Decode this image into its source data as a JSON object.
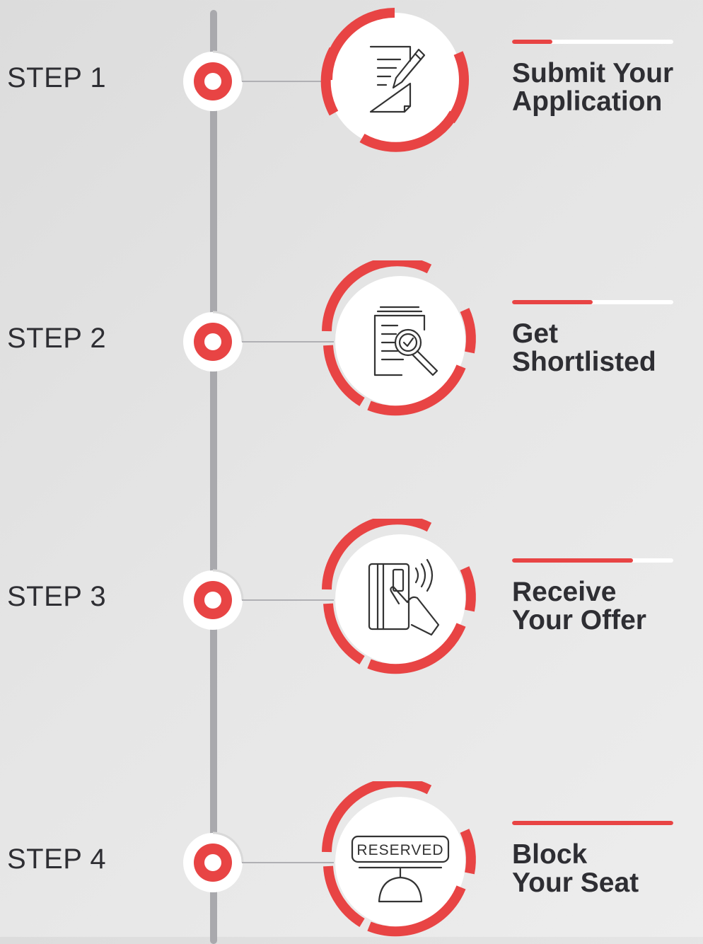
{
  "colors": {
    "accent": "#e84444",
    "line": "#a9a9ad",
    "text": "#2e2e33"
  },
  "steps": [
    {
      "label": "STEP 1",
      "title_line1": "Submit Your",
      "title_line2": "Application",
      "icon": "application-form-pen-icon",
      "progress": 0.25
    },
    {
      "label": "STEP 2",
      "title_line1": "Get",
      "title_line2": "Shortlisted",
      "icon": "document-magnifier-check-icon",
      "progress": 0.5
    },
    {
      "label": "STEP 3",
      "title_line1": "Receive",
      "title_line2": "Your Offer",
      "icon": "hand-card-offer-icon",
      "progress": 0.75
    },
    {
      "label": "STEP 4",
      "title_line1": "Block",
      "title_line2": "Your Seat",
      "icon": "reserved-sign-icon",
      "progress": 1.0,
      "icon_text": "RESERVED"
    }
  ]
}
